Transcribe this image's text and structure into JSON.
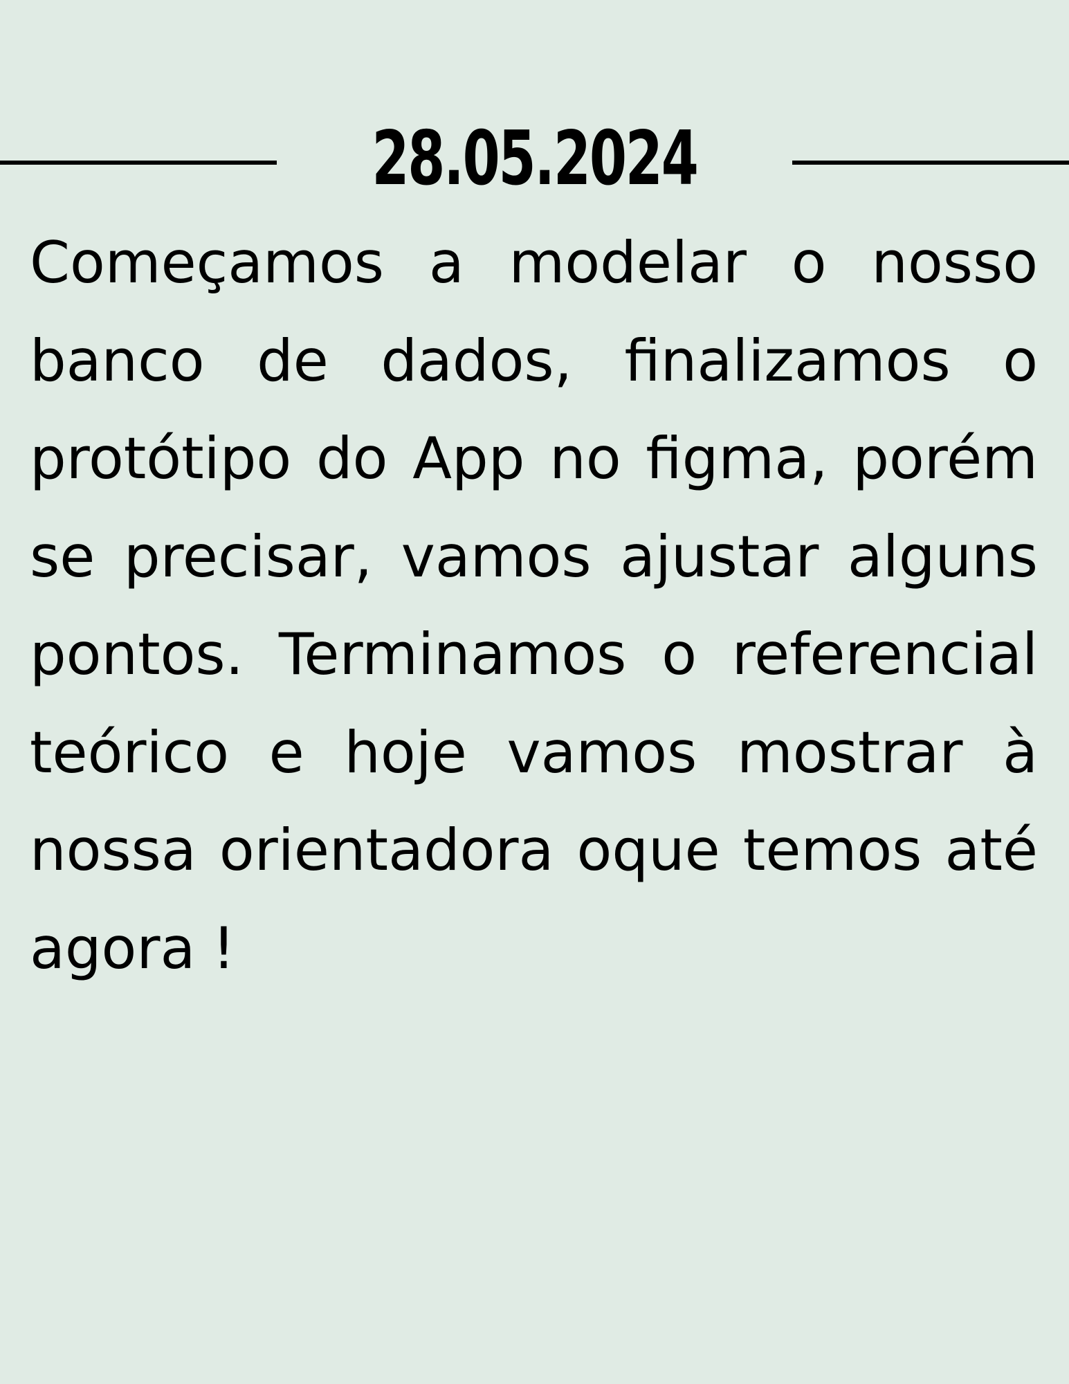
{
  "entry": {
    "date": "28.05.2024",
    "body": "Começamos a modelar o nosso banco de dados, finalizamos o protótipo do App no figma, porém se precisar, vamos ajustar alguns pontos. Terminamos o referencial teórico e hoje vamos mostrar à nossa orientadora oque temos até agora !"
  },
  "colors": {
    "background": "#e0ebe4",
    "text": "#000000",
    "rules": "#000000"
  }
}
